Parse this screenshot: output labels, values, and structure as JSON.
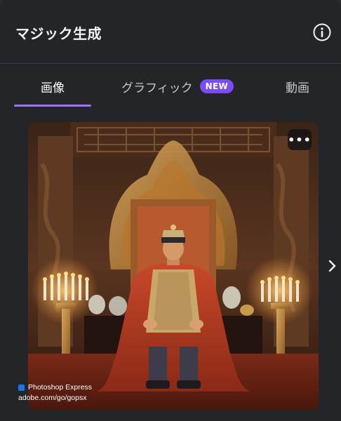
{
  "panel": {
    "title": "マジック生成",
    "icons": {
      "info": "info-circle-icon",
      "more": "more-horizontal-icon",
      "next": "chevron-right-icon"
    }
  },
  "tabs": [
    {
      "label": "画像",
      "active": true
    },
    {
      "label": "グラフィック",
      "badge": "NEW",
      "active": false
    },
    {
      "label": "動画",
      "active": false
    }
  ],
  "image": {
    "more_label": "•••",
    "watermark_line1": "Photoshop Express",
    "watermark_line2": "adobe.com/go/gopsx"
  },
  "colors": {
    "accent": "#9b74f0",
    "badge": "#7b4bf5",
    "panel_bg": "#242528"
  }
}
